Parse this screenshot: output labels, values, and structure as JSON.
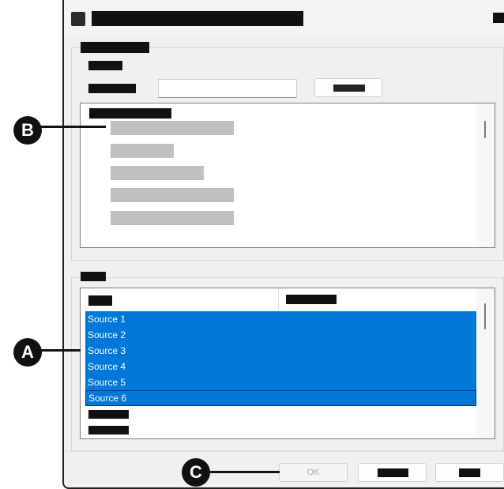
{
  "dialog": {
    "ok_label": "OK"
  },
  "sources_table": {
    "rows": [
      {
        "label": "Source 1",
        "selected": true
      },
      {
        "label": "Source 2",
        "selected": true
      },
      {
        "label": "Source 3",
        "selected": true
      },
      {
        "label": "Source 4",
        "selected": true
      },
      {
        "label": "Source 5",
        "selected": true
      },
      {
        "label": "Source 6",
        "selected": true,
        "focused": true
      }
    ]
  },
  "callouts": {
    "a": "A",
    "b": "B",
    "c": "C"
  },
  "colors": {
    "selection": "#0078d7",
    "redaction": "#111111",
    "placeholder_gray": "#c0c0c0"
  }
}
